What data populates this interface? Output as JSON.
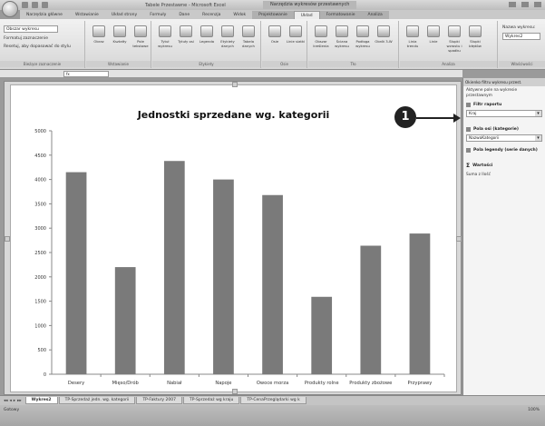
{
  "window": {
    "app_title": "Tabele Przestawne - Microsoft Excel",
    "context_title": "Narzędzia wykresów przestawnych"
  },
  "tabs": [
    {
      "label": "Narzędzia główne",
      "state": "normal"
    },
    {
      "label": "Wstawianie",
      "state": "normal"
    },
    {
      "label": "Układ strony",
      "state": "normal"
    },
    {
      "label": "Formuły",
      "state": "normal"
    },
    {
      "label": "Dane",
      "state": "normal"
    },
    {
      "label": "Recenzja",
      "state": "normal"
    },
    {
      "label": "Widok",
      "state": "normal"
    },
    {
      "label": "Projektowanie",
      "state": "ctx"
    },
    {
      "label": "Układ",
      "state": "active"
    },
    {
      "label": "Formatowanie",
      "state": "ctx"
    },
    {
      "label": "Analiza",
      "state": "ctx"
    }
  ],
  "ribbon": {
    "selection_box": "Obszar wykresu",
    "selection_actions": [
      "Formatuj zaznaczenie",
      "Resetuj, aby dopasować do stylu"
    ],
    "groups": [
      {
        "label": "Bieżące zaznaczenie",
        "buttons": []
      },
      {
        "label": "Wstawianie",
        "buttons": [
          "Obraz",
          "Kształty",
          "Pole tekstowe"
        ]
      },
      {
        "label": "Etykiety",
        "buttons": [
          "Tytuł wykresu",
          "Tytuły osi",
          "Legenda",
          "Etykiety danych",
          "Tabela danych"
        ]
      },
      {
        "label": "Osie",
        "buttons": [
          "Osie",
          "Linie siatki"
        ]
      },
      {
        "label": "Tło",
        "buttons": [
          "Obszar kreślenia",
          "Ściana wykresu",
          "Podłoga wykresu",
          "Obrót 3-W"
        ]
      },
      {
        "label": "Analiza",
        "buttons": [
          "Linia trendu",
          "Linie",
          "Słupki wzrostu i spadku",
          "Słupki błędów"
        ]
      },
      {
        "label": "Właściwości",
        "buttons": []
      }
    ],
    "chart_name_label": "Nazwa wykresu:",
    "chart_name_value": "Wykres2"
  },
  "formula_bar": {
    "name_box": "",
    "fx": "fx"
  },
  "chart_data": {
    "type": "bar",
    "title": "Jednostki sprzedane wg. kategorii",
    "xlabel": "",
    "ylabel": "",
    "categories": [
      "Desery",
      "Mięso/Drób",
      "Nabiał",
      "Napoje",
      "Owoce morza",
      "Produkty rolne",
      "Produkty zbożowe",
      "Przyprawy"
    ],
    "values": [
      4150,
      2200,
      4380,
      4000,
      3680,
      1590,
      2640,
      2890
    ],
    "ylim": [
      0,
      5000
    ],
    "yticks": [
      0,
      500,
      1000,
      1500,
      2000,
      2500,
      3000,
      3500,
      4000,
      4500,
      5000
    ],
    "grid": false,
    "bar_color": "#7a7a7a"
  },
  "pane": {
    "header": "Okienko filtru wykresu przest.",
    "active_fields_text": "Aktywne pole na wykresie przestawnym",
    "sections": [
      {
        "title": "Filtr raportu",
        "value": "Kraj"
      },
      {
        "title": "Pola osi (kategorie)",
        "value": "NazwaKategorii"
      },
      {
        "title": "Pola legendy (serie danych)",
        "value": ""
      },
      {
        "title": "Wartości",
        "value": "Suma z Ilość"
      }
    ]
  },
  "callout": {
    "number": "1"
  },
  "sheets": [
    "Wykres2",
    "TP-Sprzedaż jedn. wg. kategorii",
    "TP-Faktury 2007",
    "TP-Sprzedaż wg kraju",
    "TP-CenaPrzeglądarki wg k"
  ],
  "status": {
    "left": "Gotowy",
    "zoom": "100%"
  }
}
